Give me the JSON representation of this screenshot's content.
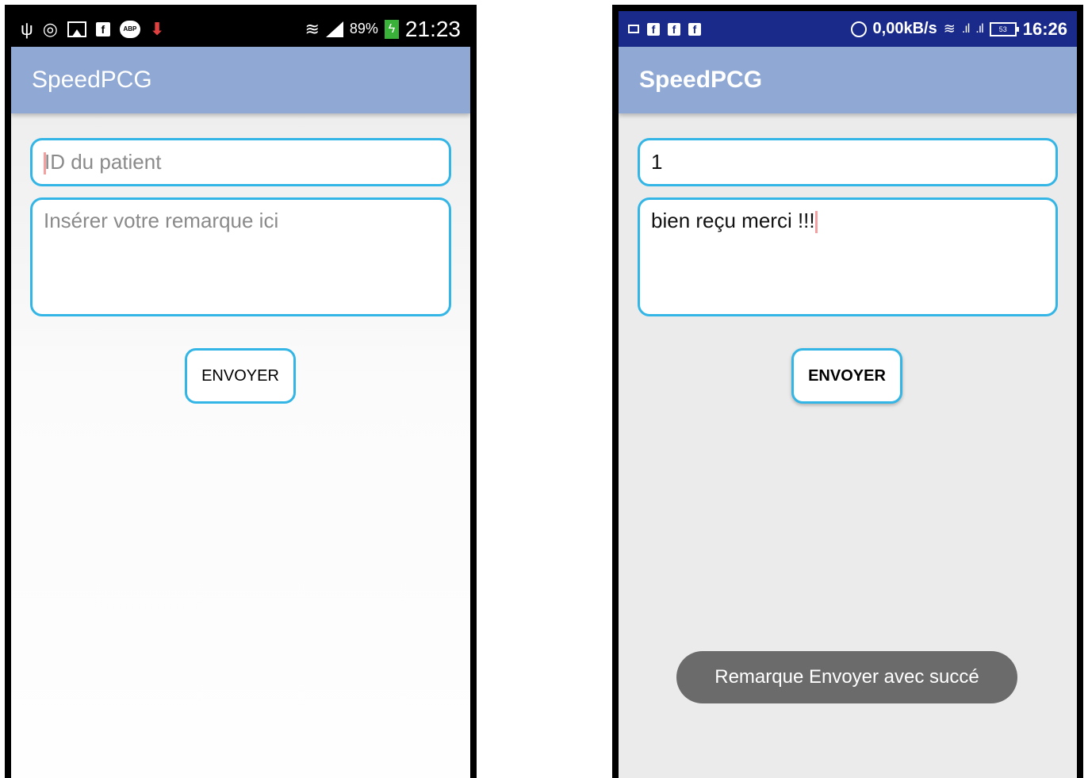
{
  "left_screen": {
    "status_bar": {
      "icons": [
        "usb-icon",
        "accessibility-icon",
        "image-icon",
        "facebook-icon",
        "adblock-icon",
        "download-icon",
        "wifi-icon",
        "signal-icon",
        "battery-charging-icon"
      ],
      "battery": "89%",
      "time": "21:23"
    },
    "app_title": "SpeedPCG",
    "patient_id": {
      "placeholder": "ID du patient",
      "value": ""
    },
    "remark": {
      "placeholder": "Insérer votre remarque ici",
      "value": ""
    },
    "send_label": "ENVOYER"
  },
  "right_screen": {
    "status_bar": {
      "icons": [
        "image-icon",
        "facebook-icon",
        "facebook-icon",
        "facebook-icon",
        "data-saver-icon",
        "wifi-icon",
        "signal-sim1-icon",
        "signal-sim2-icon",
        "battery-icon"
      ],
      "speed": "0,00kB/s",
      "battery": "53",
      "time": "16:26"
    },
    "app_title": "SpeedPCG",
    "patient_id": {
      "placeholder": "",
      "value": "1"
    },
    "remark": {
      "placeholder": "",
      "value": "bien reçu merci !!!"
    },
    "send_label": "ENVOYER",
    "toast": "Remarque Envoyer avec succé"
  },
  "colors": {
    "app_bar": "#90a8d4",
    "field_border": "#33b5e5",
    "status_bar_right": "#1a2a8a",
    "toast_bg": "#6b6b6b"
  }
}
